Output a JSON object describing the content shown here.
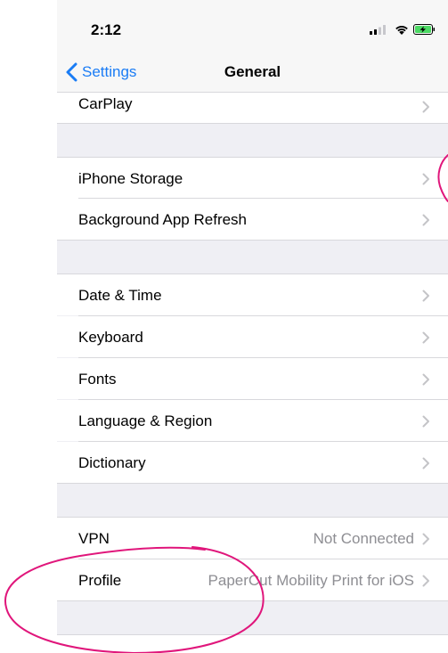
{
  "status_bar": {
    "time": "2:12",
    "battery_color": "#4cd964"
  },
  "nav": {
    "back_label": "Settings",
    "title": "General"
  },
  "groups": [
    {
      "items": [
        {
          "label": "CarPlay"
        }
      ]
    },
    {
      "items": [
        {
          "label": "iPhone Storage"
        },
        {
          "label": "Background App Refresh"
        }
      ]
    },
    {
      "items": [
        {
          "label": "Date & Time"
        },
        {
          "label": "Keyboard"
        },
        {
          "label": "Fonts"
        },
        {
          "label": "Language & Region"
        },
        {
          "label": "Dictionary"
        }
      ]
    },
    {
      "items": [
        {
          "label": "VPN",
          "value": "Not Connected"
        },
        {
          "label": "Profile",
          "value": "PaperCut Mobility Print for iOS"
        }
      ]
    }
  ],
  "colors": {
    "accent": "#1a7cf5",
    "annotation": "#e0167b"
  }
}
